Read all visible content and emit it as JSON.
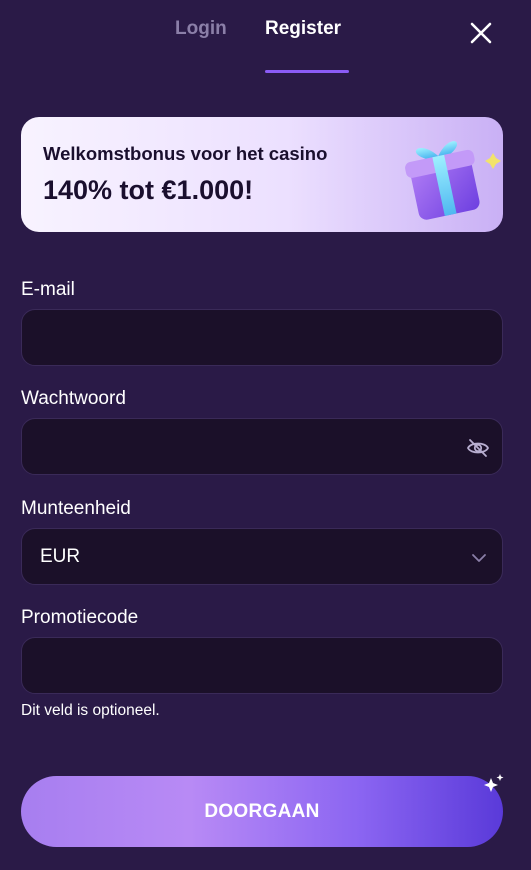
{
  "tabs": {
    "login": "Login",
    "register": "Register",
    "active": "Register"
  },
  "icons": {
    "close": "close-icon",
    "gift": "gift-icon",
    "eye_off": "eye-off-icon",
    "chevron": "chevron-down-icon",
    "sparkle": "sparkle-icon"
  },
  "banner": {
    "subtitle": "Welkomstbonus voor het casino",
    "headline": "140% tot €1.000!"
  },
  "form": {
    "email": {
      "label": "E-mail",
      "value": ""
    },
    "password": {
      "label": "Wachtwoord",
      "value": ""
    },
    "currency": {
      "label": "Munteenheid",
      "value": "EUR"
    },
    "promo": {
      "label": "Promotiecode",
      "value": "",
      "hint": "Dit veld is optioneel."
    }
  },
  "submit_label": "DOORGAAN",
  "colors": {
    "background": "#2a1a47",
    "field": "#1b1029",
    "accent": "#8b5cf6",
    "inactive_tab": "#8b7fa8"
  }
}
